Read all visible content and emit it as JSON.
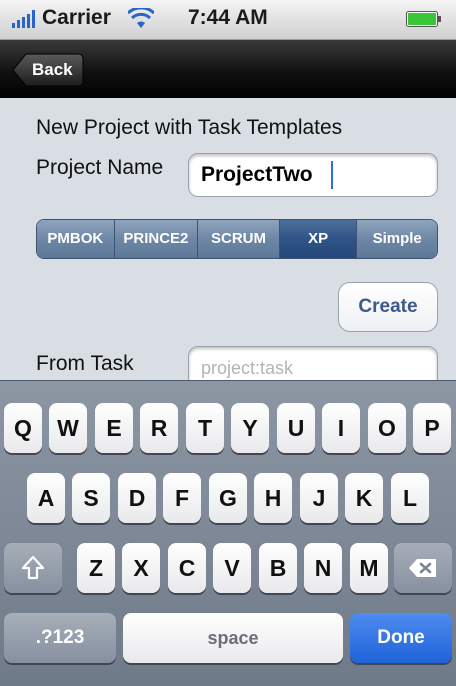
{
  "status_bar": {
    "carrier": "Carrier",
    "time": "7:44 AM"
  },
  "nav": {
    "back_label": "Back"
  },
  "form": {
    "heading": "New Project with Task Templates",
    "project_name_label": "Project Name",
    "project_name_value": "ProjectTwo",
    "templates": [
      "PMBOK",
      "PRINCE2",
      "SCRUM",
      "XP",
      "Simple"
    ],
    "selected_template": "XP",
    "create_label": "Create",
    "from_task_label": "From Task",
    "from_task_placeholder": "project:task"
  },
  "keyboard": {
    "row1": [
      "Q",
      "W",
      "E",
      "R",
      "T",
      "Y",
      "U",
      "I",
      "O",
      "P"
    ],
    "row2": [
      "A",
      "S",
      "D",
      "F",
      "G",
      "H",
      "J",
      "K",
      "L"
    ],
    "row3": [
      "Z",
      "X",
      "C",
      "V",
      "B",
      "N",
      "M"
    ],
    "numbers_label": ".?123",
    "space_label": "space",
    "done_label": "Done",
    "icons": {
      "shift": "shift-icon",
      "delete": "backspace-icon"
    }
  },
  "colors": {
    "accent": "#1f63d8",
    "segment_selected": "#2f5487",
    "segment": "#6e87a6",
    "create_text": "#3a5a8a"
  }
}
